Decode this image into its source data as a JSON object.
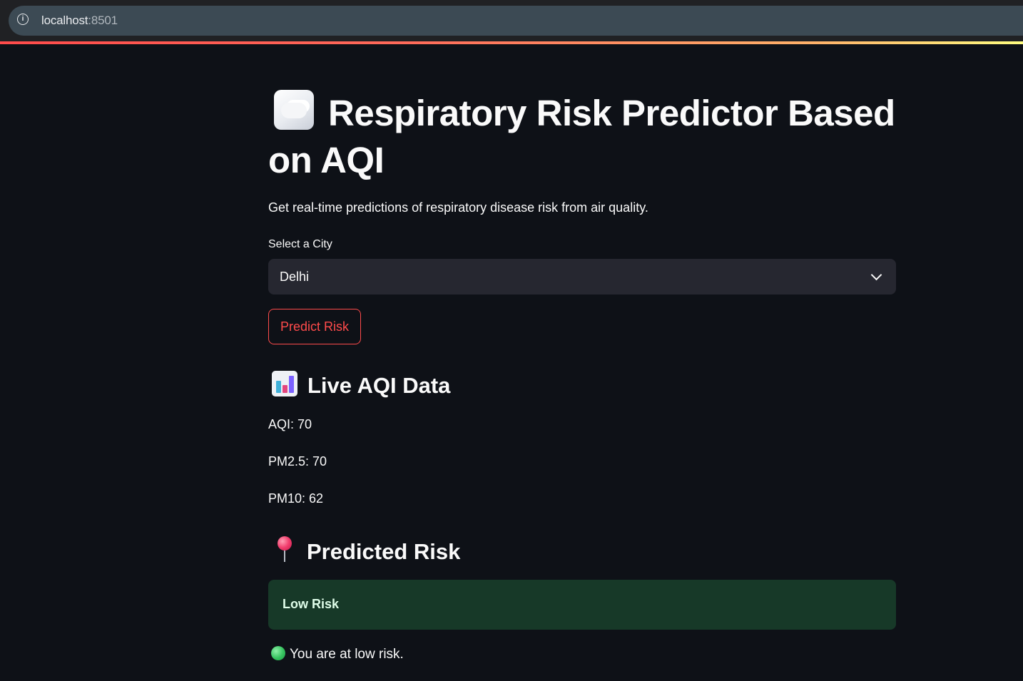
{
  "browser": {
    "url_host": "localhost",
    "url_port": ":8501",
    "info_icon": "info-icon"
  },
  "page": {
    "title_icon": "cloud-icon",
    "title": "Respiratory Risk Predictor Based on AQI",
    "subtitle": "Get real-time predictions of respiratory disease risk from air quality.",
    "city_select": {
      "label": "Select a City",
      "value": "Delhi",
      "icon": "chevron-down-icon"
    },
    "predict_button_label": "Predict Risk",
    "live_section": {
      "icon": "bar-chart-icon",
      "heading": "Live AQI Data",
      "aqi": "AQI: 70",
      "pm25": "PM2.5: 70",
      "pm10": "PM10: 62"
    },
    "prediction_section": {
      "icon": "round-pushpin-icon",
      "heading": "Predicted Risk",
      "risk_label": "Low Risk",
      "status_icon": "green-circle-icon",
      "status_message": "You are at low risk."
    }
  },
  "colors": {
    "background": "#0e1117",
    "accent": "#ff4b4b",
    "success_bg": "#173928",
    "input_bg": "#262730"
  }
}
